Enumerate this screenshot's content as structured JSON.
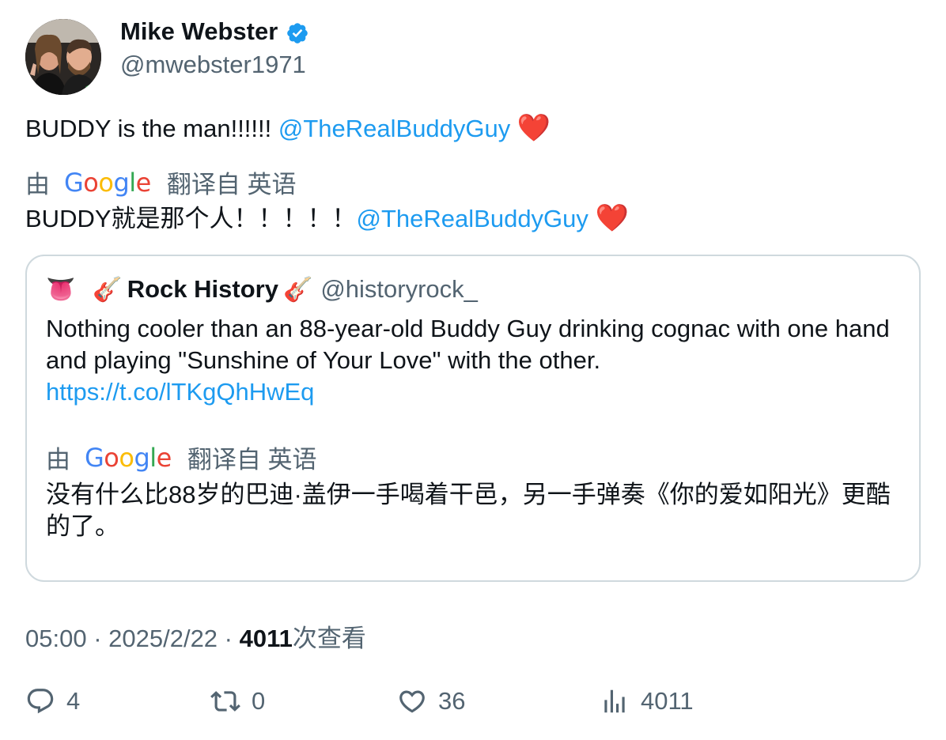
{
  "author": {
    "display_name": "Mike Webster",
    "handle": "@mwebster1971"
  },
  "tweet": {
    "text": "BUDDY is the man!!!!!! ",
    "mention": "@TheRealBuddyGuy",
    "emoji": "❤️"
  },
  "translation": {
    "by": "由",
    "google": [
      "G",
      "o",
      "o",
      "g",
      "l",
      "e"
    ],
    "from": "翻译自 英语",
    "text": "BUDDY就是那个人！！！！！",
    "mention": "@TheRealBuddyGuy",
    "emoji": "❤️"
  },
  "quote": {
    "emoji_left": "👅",
    "guitar": "🎸",
    "name": "Rock History",
    "handle": "@historyrock_",
    "text": "Nothing cooler than an 88-year-old Buddy Guy drinking cognac with one hand and playing \"Sunshine of Your Love\" with the other.",
    "link": "https://t.co/lTKgQhHwEq",
    "translation_by": "由",
    "translation_from": "翻译自 英语",
    "translation_text": "没有什么比88岁的巴迪·盖伊一手喝着干邑，另一手弹奏《你的爱如阳光》更酷的了。"
  },
  "meta": {
    "time": "05:00",
    "sep1": " · ",
    "date": "2025/2/22",
    "sep2": " · ",
    "views_count": "4011",
    "views_label": "次查看"
  },
  "actions": {
    "replies": "4",
    "retweets": "0",
    "likes": "36",
    "views": "4011"
  },
  "icons": {
    "verified": "verified-badge-icon",
    "reply": "reply-icon",
    "retweet": "retweet-icon",
    "like": "heart-icon",
    "views": "analytics-icon"
  },
  "colors": {
    "link": "#1d9bf0",
    "secondary": "#536471",
    "verified": "#1d9bf0",
    "heart": "#e8202e"
  }
}
